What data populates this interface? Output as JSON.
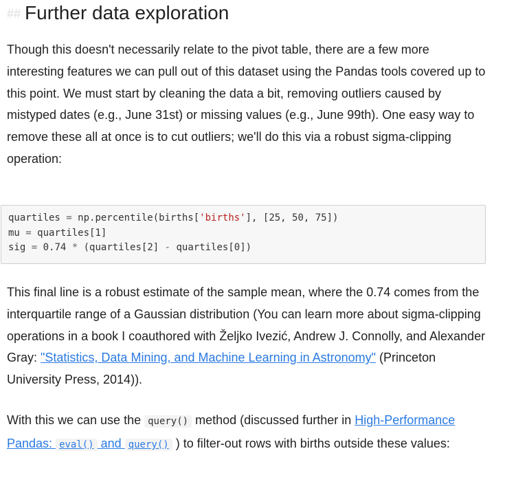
{
  "heading": {
    "hashes": "##",
    "title": "Further data exploration"
  },
  "paragraph1": "Though this doesn't necessarily relate to the pivot table, there are a few more interesting features we can pull out of this dataset using the Pandas tools covered up to this point. We must start by cleaning the data a bit, removing outliers caused by mistyped dates (e.g., June 31st) or missing values (e.g., June 99th). One easy way to remove these all at once is to cut outliers; we'll do this via a robust sigma-clipping operation:",
  "code": {
    "line1": {
      "a": "quartiles ",
      "op1": "=",
      "b": " np.percentile(births[",
      "str": "'births'",
      "c": "], [25, 50, 75])"
    },
    "line2": {
      "a": "mu ",
      "op1": "=",
      "b": " quartiles[1]"
    },
    "line3": {
      "a": "sig ",
      "op1": "=",
      "b": " 0.74 ",
      "op2": "*",
      "c": " (quartiles[2] ",
      "op3": "-",
      "d": " quartiles[0])"
    }
  },
  "paragraph2": {
    "text": "This final line is a robust estimate of the sample mean, where the 0.74 comes from the interquartile range of a Gaussian distribution (You can learn more about sigma-clipping operations in a book I coauthored with Željko Ivezić, Andrew J. Connolly, and Alexander Gray: ",
    "link": "\"Statistics, Data Mining, and Machine Learning in Astronomy\"",
    "tail": " (Princeton University Press, 2014))."
  },
  "paragraph3": {
    "pre": "With this we can use the ",
    "code_query": "query()",
    "mid": " method (discussed further in ",
    "link_text": "High-Performance Pandas: ",
    "link_code_eval": "eval()",
    "link_and": " and ",
    "link_code_query": "query()",
    "post": " ) to filter-out rows with births outside these values:"
  },
  "colors": {
    "text": "#222222",
    "link": "#2a7ae2",
    "code_string": "#ba2121",
    "code_background": "#f7f7f7",
    "heading_hashes": "#dddddd"
  }
}
